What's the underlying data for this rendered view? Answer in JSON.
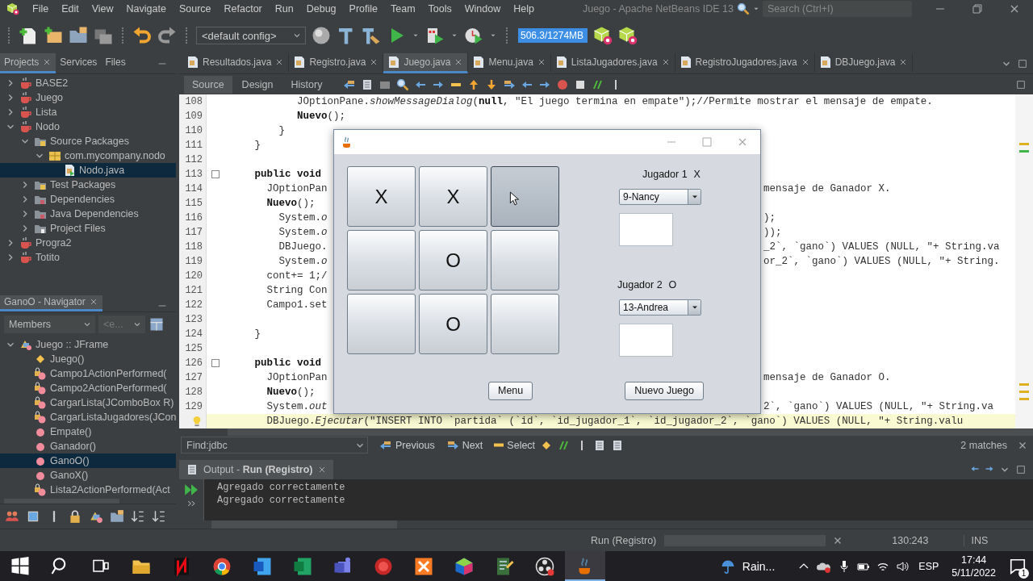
{
  "window": {
    "title": "Juego - Apache NetBeans IDE 13"
  },
  "menu": [
    "File",
    "Edit",
    "View",
    "Navigate",
    "Source",
    "Refactor",
    "Run",
    "Debug",
    "Profile",
    "Team",
    "Tools",
    "Window",
    "Help"
  ],
  "search": {
    "placeholder": "Search (Ctrl+I)"
  },
  "toolbar": {
    "config": "<default config>",
    "memory": "506.3/1274MB"
  },
  "left_tabs": [
    {
      "label": "Projects",
      "selected": true
    },
    {
      "label": "Services",
      "selected": false
    },
    {
      "label": "Files",
      "selected": false
    }
  ],
  "projects": [
    {
      "label": "BASE2",
      "kind": "project",
      "expanded": false,
      "selected": false
    },
    {
      "label": "Juego",
      "kind": "project",
      "expanded": false,
      "selected": false
    },
    {
      "label": "Lista",
      "kind": "project",
      "expanded": false,
      "selected": false
    },
    {
      "label": "Nodo",
      "kind": "project",
      "expanded": true,
      "selected": false,
      "children": [
        {
          "label": "Source Packages",
          "kind": "source-folder",
          "expanded": true,
          "selected": false,
          "children": [
            {
              "label": "com.mycompany.nodo",
              "kind": "package",
              "expanded": true,
              "selected": false,
              "children": [
                {
                  "label": "Nodo.java",
                  "kind": "java-file",
                  "selected": true
                }
              ]
            }
          ]
        },
        {
          "label": "Test Packages",
          "kind": "source-folder",
          "expanded": false,
          "selected": false
        },
        {
          "label": "Dependencies",
          "kind": "library-folder",
          "expanded": false,
          "selected": false
        },
        {
          "label": "Java Dependencies",
          "kind": "library-folder",
          "expanded": false,
          "selected": false
        },
        {
          "label": "Project Files",
          "kind": "files-folder",
          "expanded": false,
          "selected": false
        }
      ]
    },
    {
      "label": "Progra2",
      "kind": "project",
      "expanded": false,
      "selected": false
    },
    {
      "label": "Totito",
      "kind": "project",
      "expanded": false,
      "selected": false
    }
  ],
  "navigator": {
    "title": "GanoO - Navigator",
    "filter": "Members",
    "filter_2": "<e...",
    "tree": [
      {
        "label": "Juego :: JFrame",
        "kind": "class",
        "expanded": true,
        "selected": false,
        "children": [
          {
            "label": "Juego()",
            "kind": "constructor",
            "selected": false
          },
          {
            "label": "Campo1ActionPerformed(",
            "kind": "private-method",
            "selected": false
          },
          {
            "label": "Campo2ActionPerformed(",
            "kind": "private-method",
            "selected": false
          },
          {
            "label": "CargarLista(JComboBox R)",
            "kind": "private-method",
            "selected": false
          },
          {
            "label": "CargarListaJugadores(JCon",
            "kind": "private-method",
            "selected": false
          },
          {
            "label": "Empate()",
            "kind": "method",
            "selected": false
          },
          {
            "label": "Ganador()",
            "kind": "method",
            "selected": false
          },
          {
            "label": "GanoO()",
            "kind": "method",
            "selected": true
          },
          {
            "label": "GanoX()",
            "kind": "method",
            "selected": false
          },
          {
            "label": "Lista2ActionPerformed(Act",
            "kind": "private-method",
            "selected": false
          }
        ]
      }
    ]
  },
  "editor_tabs": [
    {
      "label": "Resultados.java",
      "selected": false
    },
    {
      "label": "Registro.java",
      "selected": false
    },
    {
      "label": "Juego.java",
      "selected": true
    },
    {
      "label": "Menu.java",
      "selected": false
    },
    {
      "label": "ListaJugadores.java",
      "selected": false
    },
    {
      "label": "RegistroJugadores.java",
      "selected": false
    },
    {
      "label": "DBJuego.java",
      "selected": false
    }
  ],
  "editor_views": [
    {
      "label": "Source",
      "selected": true
    },
    {
      "label": "Design",
      "selected": false
    },
    {
      "label": "History",
      "selected": false
    }
  ],
  "code": {
    "lines": [
      {
        "number": "108",
        "text": "            JOptionPane.*showMessageDialog*(**null**, \"El juego termina en empate\");//Permite mostrar el mensaje de empate.",
        "fold": false,
        "hint": false,
        "highlighted": false
      },
      {
        "number": "109",
        "text": "            **Nuevo**();",
        "fold": false,
        "hint": false,
        "highlighted": false
      },
      {
        "number": "110",
        "text": "         }",
        "fold": false,
        "hint": false,
        "highlighted": false
      },
      {
        "number": "111",
        "text": "     }",
        "fold": false,
        "hint": false,
        "highlighted": false
      },
      {
        "number": "112",
        "fold": false,
        "hint": false,
        "highlighted": false
      },
      {
        "number": "113",
        "text": "     **public void**",
        "fold": true,
        "hint": false,
        "highlighted": false
      },
      {
        "number": "114",
        "text": "       JOptionPan",
        "right": "mensaje de Ganador X.",
        "fold": false,
        "hint": false,
        "highlighted": false
      },
      {
        "number": "115",
        "text": "       **Nuevo**();",
        "fold": false,
        "hint": false,
        "highlighted": false
      },
      {
        "number": "116",
        "text": "         System.*o*",
        "right": ");",
        "fold": false,
        "hint": false,
        "highlighted": false
      },
      {
        "number": "117",
        "text": "         System.*o*",
        "right": "));",
        "fold": false,
        "hint": false,
        "highlighted": false
      },
      {
        "number": "118",
        "text": "         DBJuego.",
        "right": "_2`, `gano`) VALUES (NULL, \"+ String.va",
        "fold": false,
        "hint": false,
        "highlighted": false
      },
      {
        "number": "119",
        "text": "         System.*o*",
        "right": "or_2`, `gano`) VALUES (NULL, \"+ String.",
        "fold": false,
        "hint": false,
        "highlighted": false
      },
      {
        "number": "120",
        "text": "       cont+= 1;/",
        "fold": false,
        "hint": false,
        "highlighted": false
      },
      {
        "number": "121",
        "text": "       String Con",
        "fold": false,
        "hint": false,
        "highlighted": false
      },
      {
        "number": "122",
        "text": "       Campo1.set",
        "fold": false,
        "hint": false,
        "highlighted": false
      },
      {
        "number": "123",
        "fold": false,
        "hint": false,
        "highlighted": false
      },
      {
        "number": "124",
        "text": "     }",
        "fold": false,
        "hint": false,
        "highlighted": false
      },
      {
        "number": "125",
        "fold": false,
        "hint": false,
        "highlighted": false
      },
      {
        "number": "126",
        "text": "     **public void**",
        "fold": true,
        "hint": false,
        "highlighted": false
      },
      {
        "number": "127",
        "text": "       JOptionPan",
        "right": "mensaje de Ganador O.",
        "fold": false,
        "hint": false,
        "highlighted": false
      },
      {
        "number": "128",
        "text": "       **Nuevo**();",
        "fold": false,
        "hint": false,
        "highlighted": false
      },
      {
        "number": "129",
        "text": "       System.*out*",
        "right": "2`, `gano`) VALUES (NULL, \"+ String.va",
        "fold": false,
        "hint": false,
        "highlighted": false
      },
      {
        "text": "       DBJuego.*Ejecutar*(\"INSERT INTO `partida` (`id`, `id_jugador_1`, `id_jugador_2`, `gano`) VALUES (NULL, \"+ String.valu",
        "fold": false,
        "hint": true,
        "highlighted": true
      }
    ]
  },
  "dialog": {
    "cells": [
      {
        "mark": "X",
        "hovered": false
      },
      {
        "mark": "X",
        "hovered": false
      },
      {
        "hovered": true
      },
      {
        "hovered": false
      },
      {
        "mark": "O",
        "hovered": false
      },
      {
        "hovered": false
      },
      {
        "hovered": false
      },
      {
        "mark": "O",
        "hovered": false
      },
      {
        "hovered": false
      }
    ],
    "players": [
      {
        "label": "Jugador 1",
        "symbol": "X",
        "player": "9-Nancy"
      },
      {
        "label": "Jugador 2",
        "symbol": "O",
        "player": "13-Andrea"
      }
    ],
    "buttons": [
      "Menu",
      "Nuevo Juego"
    ]
  },
  "find": {
    "value": "Find:jdbc",
    "previous": "Previous",
    "next": "Next",
    "select": "Select",
    "matches": "2 matches"
  },
  "output": {
    "title": "Output - **Run (Registro)**",
    "lines": [
      "Agregado correctamente",
      "Agregado correctamente"
    ]
  },
  "status": {
    "task": "Run (Registro)",
    "position": "130:243",
    "mode": "INS"
  },
  "taskbar": {
    "weather": "Rain...",
    "language": "ESP",
    "time": "17:44",
    "date": "5/11/2022",
    "notifications": "1"
  }
}
